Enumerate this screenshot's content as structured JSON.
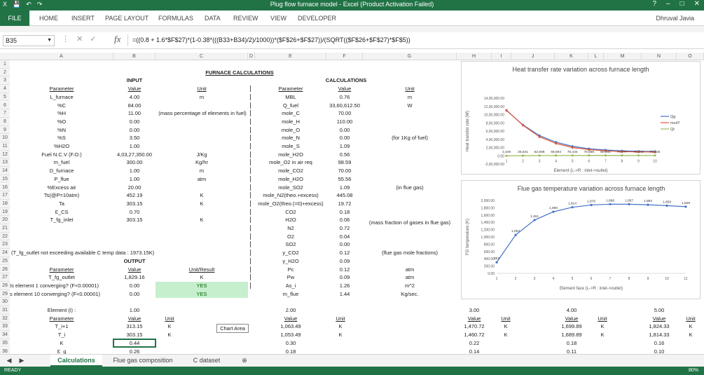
{
  "titlebar": {
    "title": "Plug flow furnace model - Excel (Product Activation Failed)",
    "help": "?",
    "minimize": "–",
    "restore": "□",
    "close": "✕"
  },
  "ribbon": {
    "file": "FILE",
    "tabs": [
      "HOME",
      "INSERT",
      "PAGE LAYOUT",
      "FORMULAS",
      "DATA",
      "REVIEW",
      "VIEW",
      "DEVELOPER"
    ],
    "user": "Dhruval Javia"
  },
  "formula_bar": {
    "name_box": "B35",
    "fx": "fx",
    "formula": "=((0.8 + 1.6*$F$27)*(1-0.38*(((B33+B34)/2)/1000))*($F$26+$F$27))/(SQRT(($F$26+$F$27)*$F$5))"
  },
  "columns": [
    "A",
    "B",
    "C",
    "D",
    "E",
    "F",
    "G",
    "H",
    "I",
    "J",
    "K",
    "L",
    "M",
    "N",
    "O"
  ],
  "rows": [
    1,
    2,
    3,
    4,
    5,
    6,
    7,
    8,
    9,
    10,
    11,
    12,
    13,
    14,
    15,
    16,
    17,
    18,
    19,
    20,
    21,
    22,
    23,
    24,
    25,
    26,
    27,
    28,
    29,
    30,
    31,
    32,
    33,
    34,
    35,
    36
  ],
  "sheet": {
    "title": "FURNACE CALCULATIONS",
    "input_header": "INPUT",
    "calc_header": "CALCULATIONS",
    "output_header": "OUTPUT",
    "hdr_parameter": "Parameter",
    "hdr_value": "Value",
    "hdr_unit": "Unit",
    "hdr_unit_result": "Unit/Result",
    "input_rows": [
      [
        "L_furnace",
        "4.00",
        "m"
      ],
      [
        "%C",
        "84.00",
        ""
      ],
      [
        "%H",
        "11.00",
        ""
      ],
      [
        "%O",
        "0.00",
        ""
      ],
      [
        "%N",
        "0.00",
        ""
      ],
      [
        "%S",
        "3.50",
        ""
      ],
      [
        "%H2O",
        "1.00",
        ""
      ],
      [
        "Fuel N.C.V (F.O.)",
        "4,03,27,350.00",
        "J/Kg"
      ],
      [
        "m_fuel",
        "300.00",
        "Kg/hr"
      ],
      [
        "D_furnace",
        "1.00",
        "m"
      ],
      [
        "P_flue",
        "1.00",
        "atm"
      ],
      [
        "%Excess air",
        "20.00",
        ""
      ],
      [
        "Ts(@P=10atm)",
        "452.19",
        "K"
      ],
      [
        "Ta",
        "303.15",
        "K"
      ],
      [
        "Ɛ_CS",
        "0.70",
        ""
      ],
      [
        "T_fg_inlet",
        "303.15",
        "K"
      ]
    ],
    "mass_pct_note": "(mass percentage of elements in fuel)",
    "calc_rows": [
      [
        "MBL",
        "0.76",
        "m"
      ],
      [
        "Q_fuel",
        "33,60,612.50",
        "W"
      ],
      [
        "mole_C",
        "70.00",
        ""
      ],
      [
        "mole_H",
        "110.00",
        ""
      ],
      [
        "mole_O",
        "0.00",
        ""
      ],
      [
        "mole_N",
        "0.00",
        ""
      ],
      [
        "mole_S",
        "1.09",
        ""
      ],
      [
        "mole_H2O",
        "0.56",
        ""
      ],
      [
        "mole_O2 in air req",
        "98.59",
        ""
      ],
      [
        "mole_CO2",
        "70.00",
        ""
      ],
      [
        "mole_H2O",
        "55.56",
        ""
      ],
      [
        "mole_SO2",
        "1.09",
        ""
      ],
      [
        "mole_N2(theo.+excess)",
        "445.08",
        ""
      ],
      [
        "mole_O2(theo.(=0)+excess)",
        "19.72",
        ""
      ],
      [
        "CO2",
        "0.18",
        ""
      ],
      [
        "H2O",
        "0.06",
        ""
      ],
      [
        "N2",
        "0.72",
        ""
      ],
      [
        "O2",
        "0.04",
        ""
      ],
      [
        "SO2",
        "0.00",
        ""
      ],
      [
        "y_CO2",
        "0.12",
        ""
      ],
      [
        "y_H2O",
        "0.09",
        ""
      ],
      [
        "Pc",
        "0.12",
        "atm"
      ],
      [
        "Pw",
        "0.09",
        "atm"
      ],
      [
        "As_i",
        "1.26",
        "m^2"
      ],
      [
        "m_flue",
        "1.44",
        "Kg/sec."
      ]
    ],
    "note_1kg": "(for 1Kg of fuel)",
    "note_flue": "(in flue gas)",
    "note_massfrac": "(mass fraction of gases in flue gas)",
    "note_molefrac": "(flue gas mole fractions)",
    "row24_note": "(T_fg_outlet not exceeding available C temp data : 1973.15K)",
    "output_rows": [
      [
        "T_fg_outlet",
        "1,829.16",
        "K"
      ],
      [
        "Is element 1 converging? (F<0.00001)",
        "0.00",
        "YES"
      ],
      [
        "s element 10 converging? (F<0.00001)",
        "0.00",
        "YES"
      ]
    ],
    "element_label": "Element (i) :",
    "element_blocks": [
      {
        "n": "1.00",
        "t1": "313.15",
        "ti": "303.15",
        "k": "0.44",
        "eps": "0.26"
      },
      {
        "n": "2.00",
        "t1": "1,063.49",
        "ti": "1,053.49",
        "k": "0.30",
        "eps": "0.18"
      },
      {
        "n": "3.00",
        "t1": "1,470.72",
        "ti": "1,460.72",
        "k": "0.22",
        "eps": "0.14"
      },
      {
        "n": "4.00",
        "t1": "1,699.89",
        "ti": "1,689.89",
        "k": "0.18",
        "eps": "0.11"
      },
      {
        "n": "5.00",
        "t1": "1,824.33",
        "ti": "1,814.33",
        "k": "0.16",
        "eps": "0.10"
      }
    ],
    "row_labels": [
      "Parameter",
      "T_i+1",
      "T_i",
      "K",
      "Ɛ_g"
    ],
    "unit_k": "K"
  },
  "tooltip": "Chart Area",
  "sheet_tabs": [
    "Calculations",
    "Flue gas composition",
    "C dataset"
  ],
  "status": {
    "ready": "READY",
    "zoom": "80%"
  },
  "chart_data": [
    {
      "type": "line",
      "title": "Heat transfer rate variation across furnace length",
      "xlabel": "Element (L->R : inlet->outlet)",
      "ylabel": "Heat transfer rate (W)",
      "ylim": [
        -2000000,
        14000000
      ],
      "x": [
        1,
        2,
        3,
        4,
        5,
        6,
        7,
        8,
        9,
        10
      ],
      "yticks": [
        "-2,00,000.00",
        "0.00",
        "2,00,000.00",
        "4,00,000.00",
        "6,00,000.00",
        "8,00,000.00",
        "10,00,000.00",
        "12,00,000.00",
        "14,00,000.00"
      ],
      "series": [
        {
          "name": "Qg",
          "color": "#4472c4",
          "values": [
            11000000,
            7500000,
            4900000,
            3300000,
            2300000,
            1700000,
            1400000,
            1200000,
            1100000,
            1050000
          ]
        },
        {
          "name": "mcdT",
          "color": "#e0573b",
          "values": [
            11100000,
            7400000,
            4600000,
            3000000,
            2000000,
            1500000,
            1200000,
            1000000,
            950000,
            900000
          ]
        },
        {
          "name": "Qt",
          "color": "#9bbb59",
          "values": [
            2449,
            26541,
            52686,
            68694,
            76434,
            79586,
            80355,
            79777,
            78343,
            76325
          ]
        }
      ],
      "data_labels": [
        "2,449",
        "26,541",
        "52,686",
        "68,694",
        "76,434",
        "79,586",
        "80,355",
        "79,777",
        "78,343",
        "76,325"
      ],
      "legend": "right"
    },
    {
      "type": "line",
      "title": "Flue gas temperature variation across furnace length",
      "xlabel": "Element face (L->R : inlet->outlet)",
      "ylabel": "FG temperature (K)",
      "ylim": [
        0,
        2000
      ],
      "x": [
        1,
        2,
        3,
        4,
        5,
        6,
        7,
        8,
        9,
        10,
        11
      ],
      "yticks": [
        "0.00",
        "200.00",
        "400.00",
        "600.00",
        "800.00",
        "1,000.00",
        "1,200.00",
        "1,400.00",
        "1,600.00",
        "1,800.00",
        "2,000.00"
      ],
      "series": [
        {
          "name": "",
          "color": "#4472c4",
          "values": [
            303,
            1053,
            1461,
            1690,
            1814,
            1876,
            1898,
            1897,
            1882,
            1858,
            1829
          ]
        }
      ],
      "data_labels": [
        "303",
        "1,053",
        "1,461",
        "1,690",
        "1,814",
        "1,876",
        "1,898",
        "1,897",
        "1,882",
        "1,858",
        "1,829"
      ]
    }
  ]
}
